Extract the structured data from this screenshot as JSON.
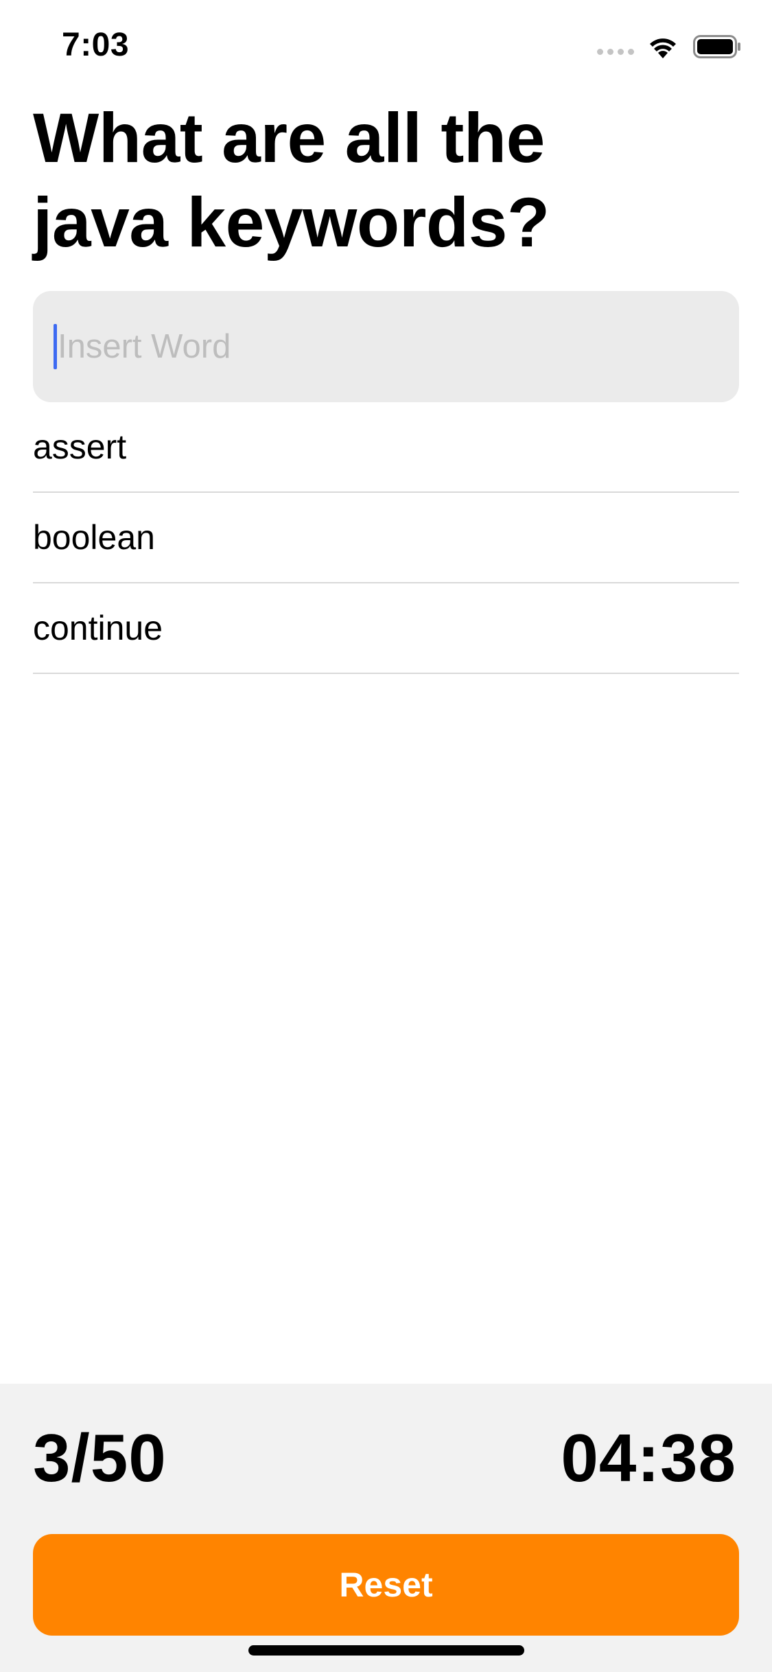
{
  "status_bar": {
    "time": "7:03",
    "signal_icon": "cellular-signal-dots-icon",
    "wifi_icon": "wifi-icon",
    "battery_icon": "battery-icon"
  },
  "quiz": {
    "title_line1": "What are all the",
    "title_line2": "java keywords?"
  },
  "search": {
    "placeholder": "Insert Word",
    "value": ""
  },
  "words": [
    "assert",
    "boolean",
    "continue"
  ],
  "footer": {
    "score": "3/50",
    "timer": "04:38",
    "reset_label": "Reset"
  },
  "colors": {
    "accent": "#ff8400",
    "caret": "#3d6af2",
    "field_bg": "#ebebeb",
    "footer_bg": "#f2f2f2"
  }
}
